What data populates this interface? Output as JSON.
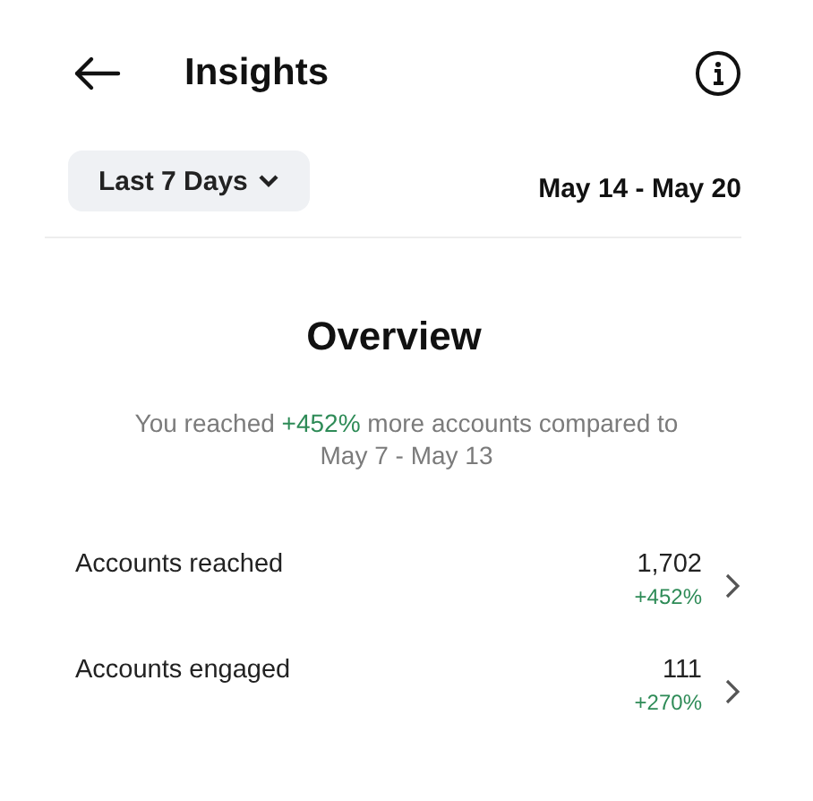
{
  "header": {
    "title": "Insights"
  },
  "filter": {
    "label": "Last 7 Days",
    "date_range": "May 14 - May 20"
  },
  "overview": {
    "title": "Overview",
    "summary": {
      "before": "You reached ",
      "highlight": "+452%",
      "after": " more accounts compared to May 7 - May 13"
    }
  },
  "metrics": [
    {
      "label": "Accounts reached",
      "value": "1,702",
      "change": "+452%"
    },
    {
      "label": "Accounts engaged",
      "value": "111",
      "change": "+270%"
    }
  ]
}
